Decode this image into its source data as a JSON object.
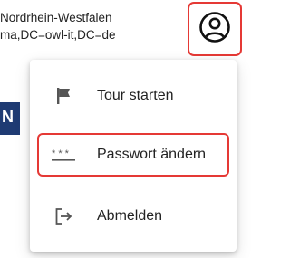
{
  "header": {
    "line1": "Nordrhein-Westfalen",
    "line2": "ma,DC=owl-it,DC=de"
  },
  "avatar": {
    "icon": "account-circle-icon",
    "highlight_color": "#e53935"
  },
  "background": {
    "partial_letter": "N",
    "block_color": "#1f3b73"
  },
  "menu": {
    "items": [
      {
        "label": "Tour starten",
        "icon": "flag-icon"
      },
      {
        "label": "Passwort ändern",
        "icon": "password-icon",
        "highlighted": true
      },
      {
        "label": "Abmelden",
        "icon": "logout-icon"
      }
    ]
  }
}
